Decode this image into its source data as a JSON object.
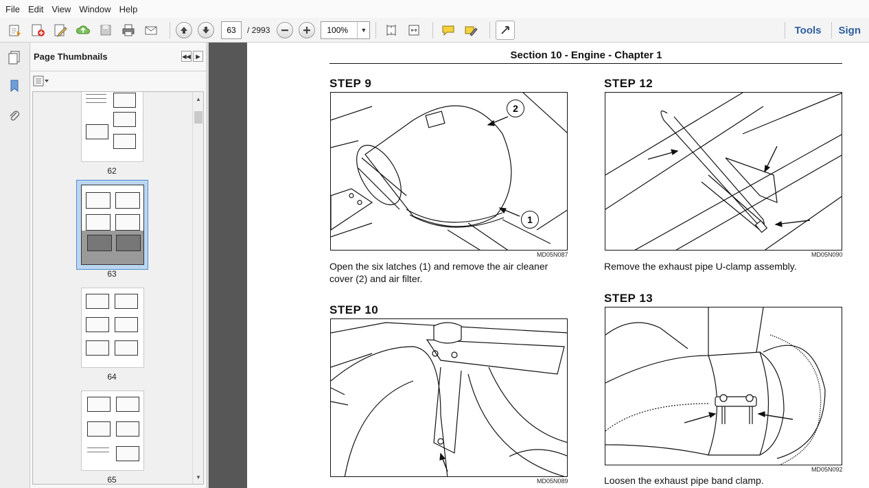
{
  "menu": [
    "File",
    "Edit",
    "View",
    "Window",
    "Help"
  ],
  "toolbar": {
    "current_page": "63",
    "page_total": "/  2993",
    "zoom": "100%",
    "tools_label": "Tools",
    "sign_label": "Sign"
  },
  "thumbnails": {
    "title": "Page Thumbnails",
    "pages": [
      "62",
      "63",
      "64",
      "65"
    ]
  },
  "document": {
    "section_title": "Section 10 - Engine - Chapter 1",
    "steps": [
      {
        "title": "STEP  9",
        "code": "MD05N087",
        "text": "Open the six latches (1) and remove the air cleaner cover (2) and air filter.",
        "callouts": [
          "2",
          "1"
        ]
      },
      {
        "title": "STEP  12",
        "code": "MD05N090",
        "text": "Remove the exhaust pipe U-clamp assembly."
      },
      {
        "title": "STEP  10",
        "code": "MD05N089",
        "text": ""
      },
      {
        "title": "STEP  13",
        "code": "MD05N092",
        "text": "Loosen the exhaust pipe band clamp."
      }
    ]
  }
}
